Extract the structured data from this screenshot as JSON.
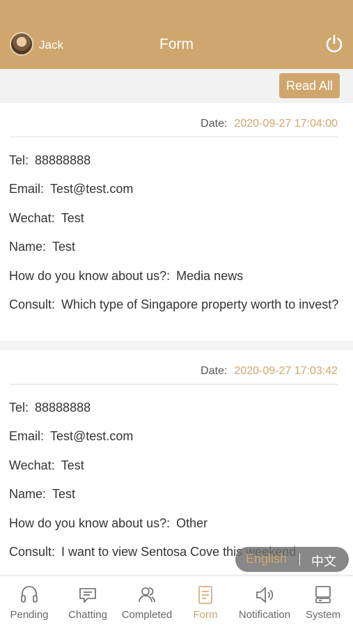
{
  "header": {
    "user_name": "Jack",
    "title": "Form",
    "accent": "#cfa66d"
  },
  "toolbar": {
    "read_all_label": "Read All"
  },
  "forms": [
    {
      "date_label": "Date:",
      "date_value": "2020-09-27 17:04:00",
      "tel_label": "Tel:",
      "tel": "88888888",
      "email_label": "Email:",
      "email": "Test@test.com",
      "wechat_label": "Wechat:",
      "wechat": "Test",
      "name_label": "Name:",
      "name": "Test",
      "source_label": "How do you know about us?:",
      "source": "Media news",
      "consult_label": "Consult:",
      "consult": "Which type of Singapore property worth to invest?"
    },
    {
      "date_label": "Date:",
      "date_value": "2020-09-27 17:03:42",
      "tel_label": "Tel:",
      "tel": "88888888",
      "email_label": "Email:",
      "email": "Test@test.com",
      "wechat_label": "Wechat:",
      "wechat": "Test",
      "name_label": "Name:",
      "name": "Test",
      "source_label": "How do you know about us?:",
      "source": "Other",
      "consult_label": "Consult:",
      "consult": "I want to view Sentosa Cove this weekend"
    }
  ],
  "language_toggle": {
    "english": "English",
    "chinese": "中文"
  },
  "tabs": [
    {
      "label": "Pending",
      "icon": "headset-icon"
    },
    {
      "label": "Chatting",
      "icon": "chat-icon"
    },
    {
      "label": "Completed",
      "icon": "users-icon"
    },
    {
      "label": "Form",
      "icon": "form-icon",
      "active": true
    },
    {
      "label": "Notification",
      "icon": "speaker-icon"
    },
    {
      "label": "System",
      "icon": "monitor-icon"
    }
  ]
}
